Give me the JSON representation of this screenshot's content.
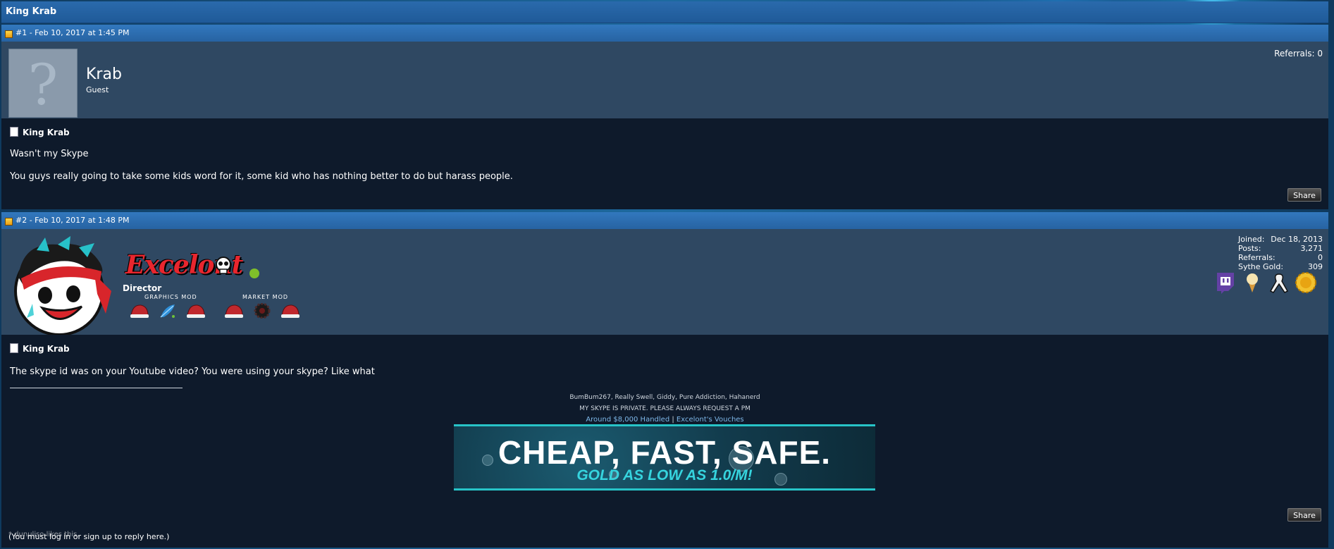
{
  "thread": {
    "title": "King Krab"
  },
  "posts": [
    {
      "number_label": "#1 - Feb 10, 2017 at 1:45 PM",
      "user": {
        "name": "Krab",
        "rank": "Guest",
        "referrals": "Referrals:  0"
      },
      "author": "King Krab",
      "paragraphs": [
        "Wasn't my Skype",
        "You guys really going to take some kids word for it, some kid who has nothing better to do but harass people."
      ],
      "share_label": "Share"
    },
    {
      "number_label": "#2 - Feb 10, 2017 at 1:48 PM",
      "user": {
        "name": "Excelont",
        "rank": "Director",
        "badge_titles": [
          "GRAPHICS MOD",
          "MARKET MOD"
        ],
        "stats": [
          {
            "label": "Joined:",
            "value": "Dec 18, 2013"
          },
          {
            "label": "Posts:",
            "value": "3,271"
          },
          {
            "label": "Referrals:",
            "value": "0"
          },
          {
            "label": "Sythe Gold:",
            "value": "309"
          }
        ],
        "profile_badges": [
          "twitch-icon",
          "ice-cream-icon",
          "ribbon-icon",
          "gold-badge-icon"
        ]
      },
      "author": "King Krab",
      "paragraphs": [
        "The skype id was on your Youtube video? You were using your skype? Like what"
      ],
      "signature": {
        "line1": "BumBum267, Really Swell, Giddy, Pure Addiction, Hahanerd",
        "line2": "MY SKYPE IS PRIVATE. PLEASE ALWAYS REQUEST A PM",
        "link1": "Around $8,000 Handled",
        "separator": "|",
        "link2": "Excelont's Vouches",
        "banner_line1": "CHEAP, FAST, SAFE.",
        "banner_line2": "GOLD AS LOW AS 1.0/M!"
      },
      "share_label": "Share"
    }
  ],
  "footer": {
    "likes_text": "* dunuliso likes this.",
    "reply_notice": "(You must log in or sign up to reply here.)"
  },
  "colors": {
    "header_blue": "#2763a2",
    "user_bar": "#2f4862",
    "body": "#0e1a2b",
    "accent_cyan": "#27c4c8"
  }
}
